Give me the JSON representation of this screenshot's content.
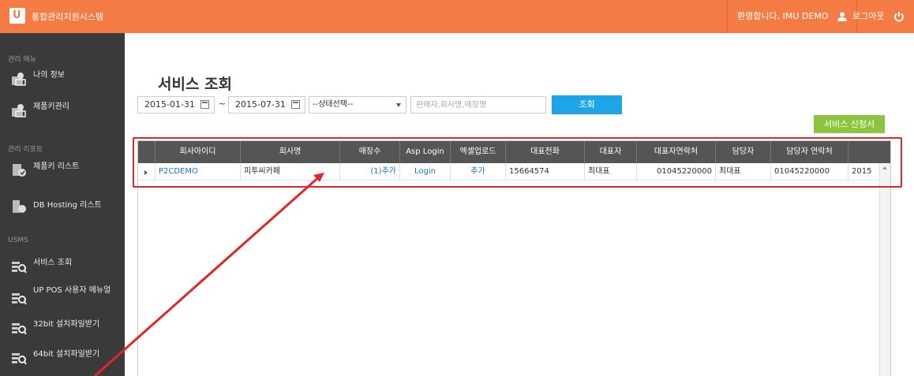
{
  "app": {
    "logo_text": "U",
    "title": "통합관리지원시스템"
  },
  "header": {
    "welcome": "환영합니다, IMU DEMO",
    "logout": "로그아웃"
  },
  "sidebar": {
    "sections": [
      "관리 메뉴",
      "관리 리포트",
      "USMS"
    ],
    "items": [
      {
        "label": "나의 정보",
        "icon": "user-card-icon"
      },
      {
        "label": "제품키관리",
        "icon": "user-card-icon"
      },
      {
        "label": "제품키 리스트",
        "icon": "report-icon"
      },
      {
        "label": "DB Hosting 리스트",
        "icon": "db-report-icon"
      },
      {
        "label": "서비스 조회",
        "icon": "search-list-icon"
      },
      {
        "label": "UP POS 사용자 메뉴얼",
        "icon": "search-list-icon"
      },
      {
        "label": "32bit 설치파일받기",
        "icon": "search-list-icon"
      },
      {
        "label": "64bit 설치파일받기",
        "icon": "search-list-icon"
      }
    ]
  },
  "main": {
    "title": "서비스 조회",
    "date_from": "2015-01-31",
    "date_separator": "~",
    "date_to": "2015-07-31",
    "status_select": "--상태선택--",
    "search_placeholder": "판매자,회사명,매장명",
    "search_button": "조회",
    "apply_button": "서비스 신청서"
  },
  "grid": {
    "columns": [
      "회사아이디",
      "회사명",
      "매장수",
      "Asp Login",
      "엑셀업로드",
      "대표전화",
      "대표자",
      "대표자연락처",
      "담당자",
      "담당자 연락처",
      ""
    ],
    "rows": [
      {
        "company_id": "P2CDEMO",
        "company_name": "피투씨카페",
        "stores": "(1)추가",
        "asp_login": "Login",
        "excel_upload": "추가",
        "phone": "15664574",
        "ceo": "최대표",
        "ceo_contact": "01045220000",
        "manager": "최대표",
        "manager_contact": "01045220000",
        "date": "2015"
      }
    ]
  },
  "colors": {
    "accent": "#f47c44",
    "sidebar": "#3a3a3a",
    "search": "#1ea5e8",
    "apply": "#8cc43f",
    "annotation": "#e0282a"
  }
}
